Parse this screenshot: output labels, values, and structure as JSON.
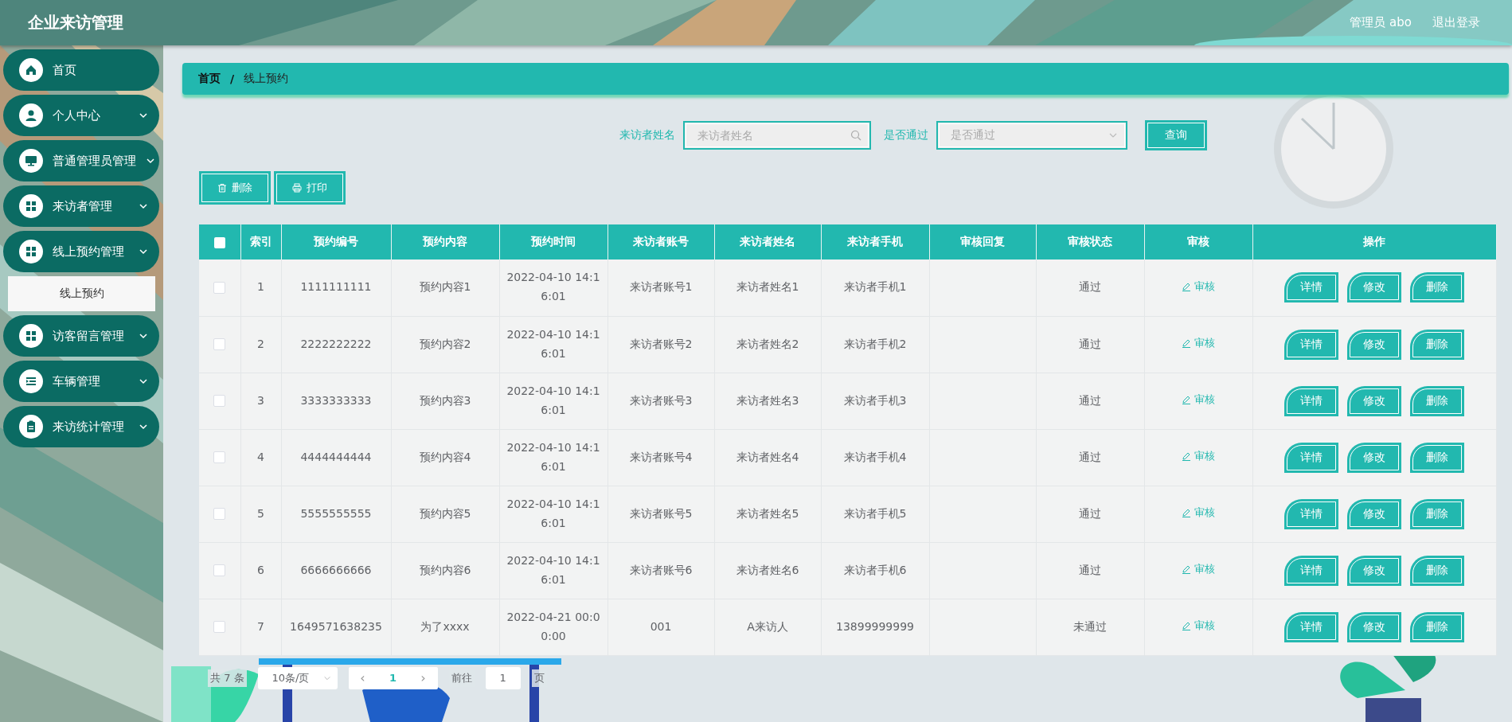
{
  "header": {
    "title": "企业来访管理",
    "user": "管理员 abo",
    "logout": "退出登录"
  },
  "sidebar": {
    "items": [
      {
        "label": "首页",
        "kind": "link"
      },
      {
        "label": "个人中心",
        "kind": "menu"
      },
      {
        "label": "普通管理员管理",
        "kind": "menu"
      },
      {
        "label": "来访者管理",
        "kind": "menu"
      },
      {
        "label": "线上预约管理",
        "kind": "menu",
        "expanded": true,
        "children": [
          {
            "label": "线上预约",
            "selected": true
          }
        ]
      },
      {
        "label": "访客留言管理",
        "kind": "menu"
      },
      {
        "label": "车辆管理",
        "kind": "menu"
      },
      {
        "label": "来访统计管理",
        "kind": "menu"
      }
    ]
  },
  "breadcrumb": {
    "items": [
      "首页",
      "线上预约"
    ],
    "separator": "/"
  },
  "search": {
    "fields": [
      {
        "kind": "input",
        "label": "来访者姓名",
        "placeholder": "来访者姓名"
      },
      {
        "kind": "select",
        "label": "是否通过",
        "placeholder": "是否通过"
      }
    ],
    "button": "查询"
  },
  "toolbar": [
    {
      "kind": "delete",
      "label": "删除"
    },
    {
      "kind": "print",
      "label": "打印"
    }
  ],
  "table": {
    "select_all_checked": false,
    "columns": [
      "索引",
      "预约编号",
      "预约内容",
      "预约时间",
      "来访者账号",
      "来访者姓名",
      "来访者手机",
      "审核回复",
      "审核状态",
      "审核",
      "操作"
    ],
    "rows": [
      {
        "checked": false,
        "index": "1",
        "code": "1111111111",
        "content": "预约内容1",
        "time": "2022-04-10 14:16:01",
        "account": "来访者账号1",
        "name": "来访者姓名1",
        "phone": "来访者手机1",
        "status": "通过",
        "review": "审核",
        "actions": [
          "详情",
          "修改",
          "删除"
        ]
      },
      {
        "checked": false,
        "index": "2",
        "code": "2222222222",
        "content": "预约内容2",
        "time": "2022-04-10 14:16:01",
        "account": "来访者账号2",
        "name": "来访者姓名2",
        "phone": "来访者手机2",
        "status": "通过",
        "review": "审核",
        "actions": [
          "详情",
          "修改",
          "删除"
        ]
      },
      {
        "checked": false,
        "index": "3",
        "code": "3333333333",
        "content": "预约内容3",
        "time": "2022-04-10 14:16:01",
        "account": "来访者账号3",
        "name": "来访者姓名3",
        "phone": "来访者手机3",
        "status": "通过",
        "review": "审核",
        "actions": [
          "详情",
          "修改",
          "删除"
        ]
      },
      {
        "checked": false,
        "index": "4",
        "code": "4444444444",
        "content": "预约内容4",
        "time": "2022-04-10 14:16:01",
        "account": "来访者账号4",
        "name": "来访者姓名4",
        "phone": "来访者手机4",
        "status": "通过",
        "review": "审核",
        "actions": [
          "详情",
          "修改",
          "删除"
        ]
      },
      {
        "checked": false,
        "index": "5",
        "code": "5555555555",
        "content": "预约内容5",
        "time": "2022-04-10 14:16:01",
        "account": "来访者账号5",
        "name": "来访者姓名5",
        "phone": "来访者手机5",
        "status": "通过",
        "review": "审核",
        "actions": [
          "详情",
          "修改",
          "删除"
        ]
      },
      {
        "checked": false,
        "index": "6",
        "code": "6666666666",
        "content": "预约内容6",
        "time": "2022-04-10 14:16:01",
        "account": "来访者账号6",
        "name": "来访者姓名6",
        "phone": "来访者手机6",
        "status": "通过",
        "review": "审核",
        "actions": [
          "详情",
          "修改",
          "删除"
        ]
      },
      {
        "checked": false,
        "index": "7",
        "code": "1649571638235",
        "content": "为了xxxx",
        "time": "2022-04-21 00:00:00",
        "account": "001",
        "name": "A来访人",
        "phone": "13899999999",
        "status": "未通过",
        "review": "审核",
        "actions": [
          "详情",
          "修改",
          "删除"
        ]
      }
    ]
  },
  "pagination": {
    "total": "共 7 条",
    "page_size": "10条/页",
    "prev": "‹",
    "pages": [
      {
        "label": "1",
        "selected": true
      }
    ],
    "next": "›",
    "goto_label": "前往",
    "goto_value": "1",
    "goto_suffix": "页"
  }
}
